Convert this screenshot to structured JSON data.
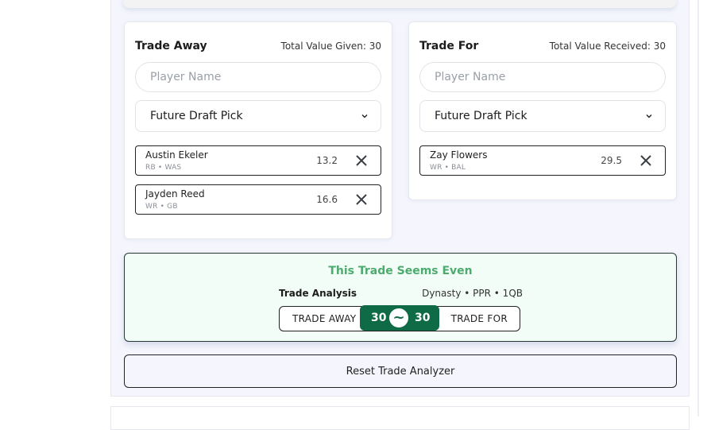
{
  "trade_away": {
    "title": "Trade Away",
    "total_label": "Total Value Given: 30",
    "player_input_placeholder": "Player Name",
    "pick_select_value": "Future Draft Pick",
    "players": [
      {
        "name": "Austin Ekeler",
        "meta": "RB • WAS",
        "value": "13.2"
      },
      {
        "name": "Jayden Reed",
        "meta": "WR • GB",
        "value": "16.6"
      }
    ]
  },
  "trade_for": {
    "title": "Trade For",
    "total_label": "Total Value Received: 30",
    "player_input_placeholder": "Player Name",
    "pick_select_value": "Future Draft Pick",
    "players": [
      {
        "name": "Zay Flowers",
        "meta": "WR • BAL",
        "value": "29.5"
      }
    ]
  },
  "analysis": {
    "verdict": "This Trade Seems Even",
    "label": "Trade Analysis",
    "settings": "Dynasty • PPR • 1QB",
    "away_label": "TRADE AWAY",
    "for_label": "TRADE FOR",
    "away_value": "30",
    "for_value": "30",
    "comparison_symbol": "~",
    "verdict_color": "#4dab6e",
    "accent_color": "#0e6b45"
  },
  "reset_button_label": "Reset Trade Analyzer",
  "icons": {
    "select": "chevron-down-icon",
    "remove": "close-icon",
    "compare": "approx-equal-icon"
  }
}
